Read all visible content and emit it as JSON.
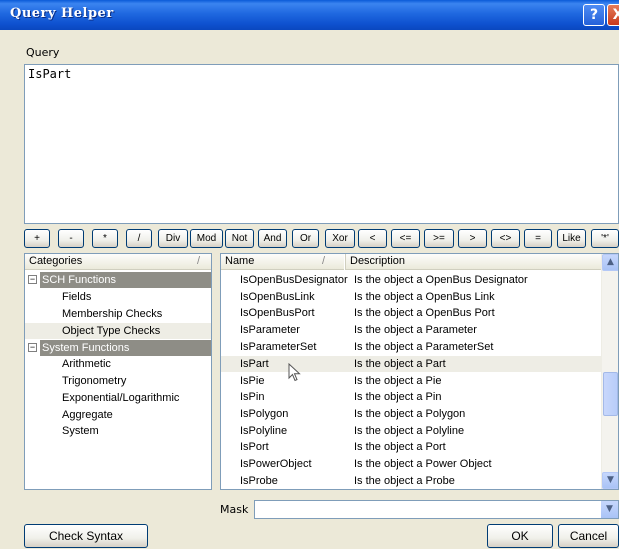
{
  "window": {
    "title": "Query Helper"
  },
  "query": {
    "label": "Query",
    "text": "IsPart"
  },
  "operators": [
    "+",
    "-",
    "*",
    "/",
    "Div",
    "Mod",
    "Not",
    "And",
    "Or",
    "Xor",
    "<",
    "<=",
    ">=",
    ">",
    "<>",
    "=",
    "Like",
    "'*'"
  ],
  "categories": {
    "header": "Categories",
    "items": [
      {
        "label": "SCH Functions",
        "type": "group",
        "expander": "−"
      },
      {
        "label": "Fields",
        "type": "child"
      },
      {
        "label": "Membership Checks",
        "type": "child"
      },
      {
        "label": "Object Type Checks",
        "type": "child",
        "selected": true
      },
      {
        "label": "System Functions",
        "type": "group",
        "expander": "−"
      },
      {
        "label": "Arithmetic",
        "type": "child"
      },
      {
        "label": "Trigonometry",
        "type": "child"
      },
      {
        "label": "Exponential/Logarithmic",
        "type": "child"
      },
      {
        "label": "Aggregate",
        "type": "child"
      },
      {
        "label": "System",
        "type": "child"
      }
    ]
  },
  "functions": {
    "headers": {
      "name": "Name",
      "description": "Description"
    },
    "rows": [
      {
        "name": "IsOpenBusDesignator",
        "description": "Is the object a OpenBus Designator"
      },
      {
        "name": "IsOpenBusLink",
        "description": "Is the object a OpenBus Link"
      },
      {
        "name": "IsOpenBusPort",
        "description": "Is the object a OpenBus Port"
      },
      {
        "name": "IsParameter",
        "description": "Is the object a Parameter"
      },
      {
        "name": "IsParameterSet",
        "description": "Is the object a ParameterSet"
      },
      {
        "name": "IsPart",
        "description": "Is the object a Part",
        "selected": true
      },
      {
        "name": "IsPie",
        "description": "Is the object a Pie"
      },
      {
        "name": "IsPin",
        "description": "Is the object a Pin"
      },
      {
        "name": "IsPolygon",
        "description": "Is the object a Polygon"
      },
      {
        "name": "IsPolyline",
        "description": "Is the object a Polyline"
      },
      {
        "name": "IsPort",
        "description": "Is the object a Port"
      },
      {
        "name": "IsPowerObject",
        "description": "Is the object a Power Object"
      },
      {
        "name": "IsProbe",
        "description": "Is the object a Probe"
      }
    ]
  },
  "mask": {
    "label": "Mask",
    "value": ""
  },
  "buttons": {
    "check_syntax": "Check Syntax",
    "ok": "OK",
    "cancel": "Cancel"
  },
  "icons": {
    "help": "?",
    "close": "X",
    "scroll_up": "▲",
    "scroll_down": "▼",
    "dropdown": "▼",
    "sort": "/"
  }
}
